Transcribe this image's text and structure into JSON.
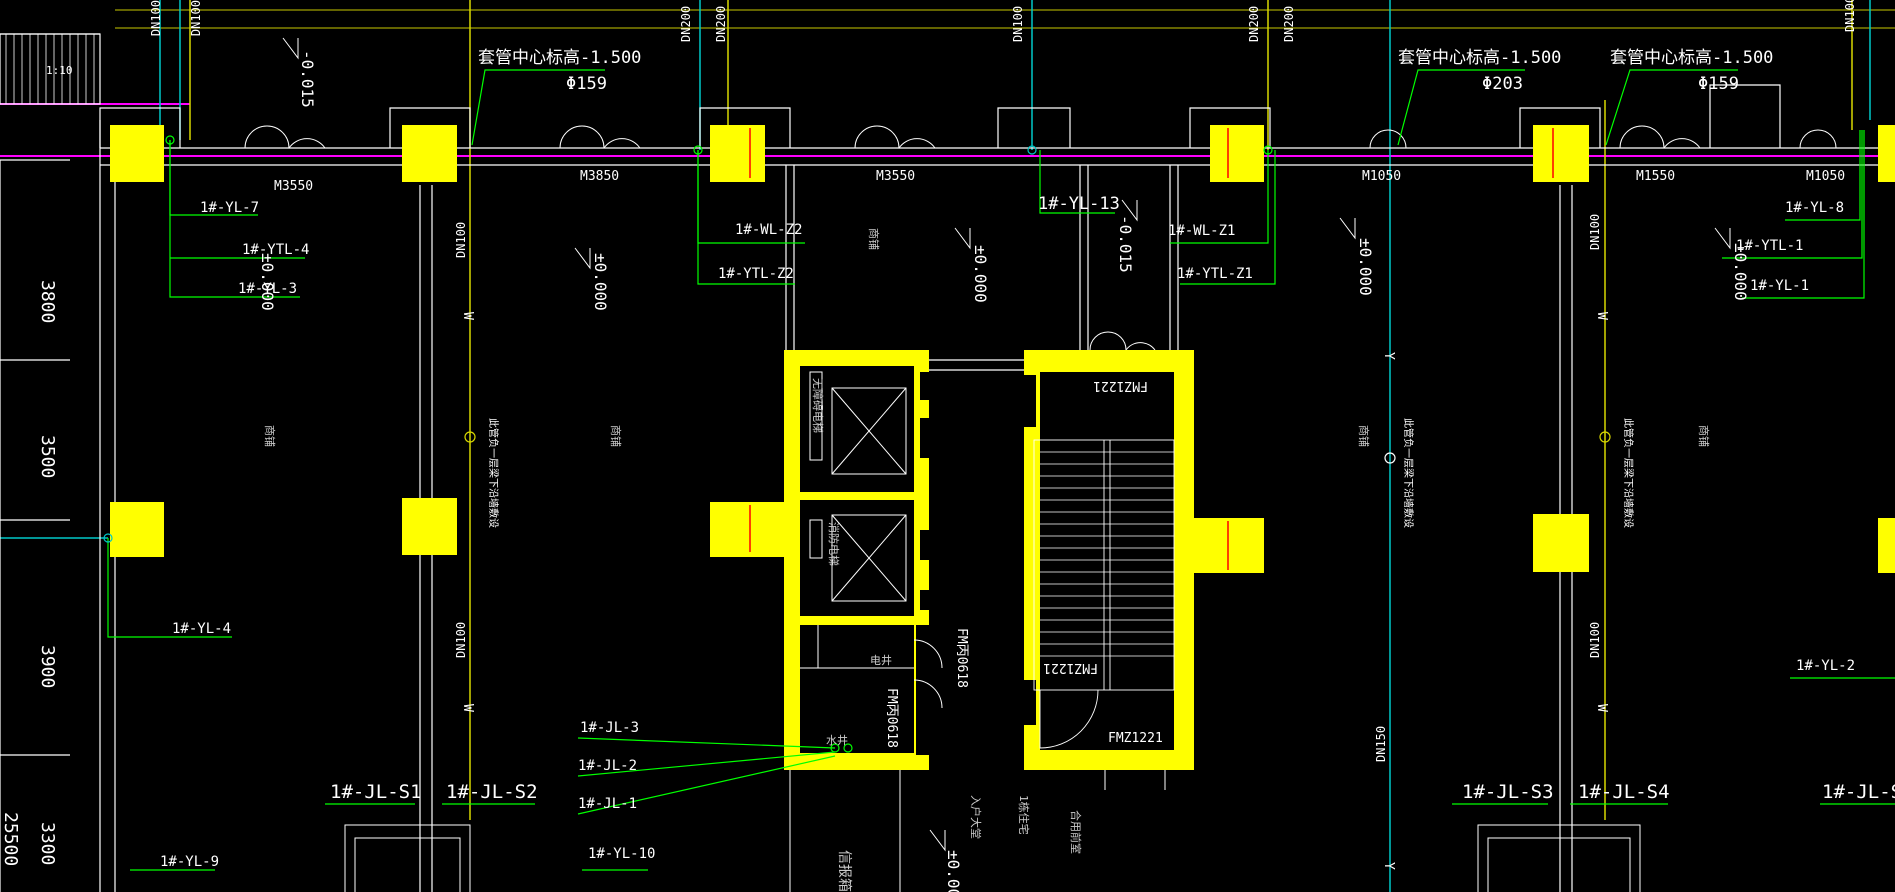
{
  "drawing": {
    "background": "#000000",
    "colors": {
      "wall": "#ffffff",
      "column": "#ffff00",
      "pipe_cyan": "#00c8c8",
      "pipe_yellow": "#d8d800",
      "leader_green": "#00ff00",
      "axis_magenta": "#ff00ff",
      "text_white": "#ffffff",
      "cut_red": "#ff0000"
    },
    "dimensions": [
      "3800",
      "3500",
      "3900",
      "3300",
      "25500"
    ],
    "pipe_sizes": {
      "dn100": "DN100",
      "dn200": "DN200",
      "dn150": "DN150"
    },
    "sleeves": [
      {
        "elevation": "套管中心标高-1.500",
        "diameter": "Φ159"
      },
      {
        "elevation": "套管中心标高-1.500",
        "diameter": "Φ203"
      },
      {
        "elevation": "套管中心标高-1.500",
        "diameter": "Φ159"
      }
    ],
    "levels": {
      "minus": "-0.015",
      "zero": "±0.000"
    },
    "scale_note": "1:10",
    "doors": [
      "M3550",
      "M3850",
      "M3550",
      "M1050",
      "M1550",
      "M1050"
    ],
    "pipe_tags": {
      "yl7": "1#-YL-7",
      "ytl4": "1#-YTL-4",
      "yl3": "1#-YL-3",
      "wlz2": "1#-WL-Z2",
      "ytlz2": "1#-YTL-Z2",
      "yl13": "1#-YL-13",
      "wlz1": "1#-WL-Z1",
      "ytlz1": "1#-YTL-Z1",
      "yl8": "1#-YL-8",
      "ytl1": "1#-YTL-1",
      "yl1": "1#-YL-1",
      "yl4": "1#-YL-4",
      "yl2": "1#-YL-2",
      "yl9": "1#-YL-9",
      "yl10": "1#-YL-10",
      "jl3": "1#-JL-3",
      "jl2": "1#-JL-2",
      "jl1": "1#-JL-1",
      "jls1": "1#-JL-S1",
      "jls2": "1#-JL-S2",
      "jls3": "1#-JL-S3",
      "jls4": "1#-JL-S4",
      "jls_partial": "1#-JL-S"
    },
    "fire_doors": {
      "fmz1221_top": "FMZ1221",
      "fmz1221_mid": "FMZ1221",
      "fmz1221_bottom": "FMZ1221",
      "fmb0618_a": "FM丙0618",
      "fmb0618_b": "FM丙0618"
    },
    "rooms": {
      "shop": "商铺",
      "elec_shaft": "电井",
      "water_shaft": "水井",
      "entry_hall": "入户大堂",
      "building": "1栋住宅",
      "public_lobby": "合用前室",
      "mailbox": "信报箱",
      "elevator_a": "无障碍电梯",
      "elevator_b": "消防电梯"
    },
    "notes": {
      "riser_note": "此管负一层梁下沿墙敷设"
    },
    "pipe_codes": {
      "w": "W",
      "y": "Y"
    }
  }
}
